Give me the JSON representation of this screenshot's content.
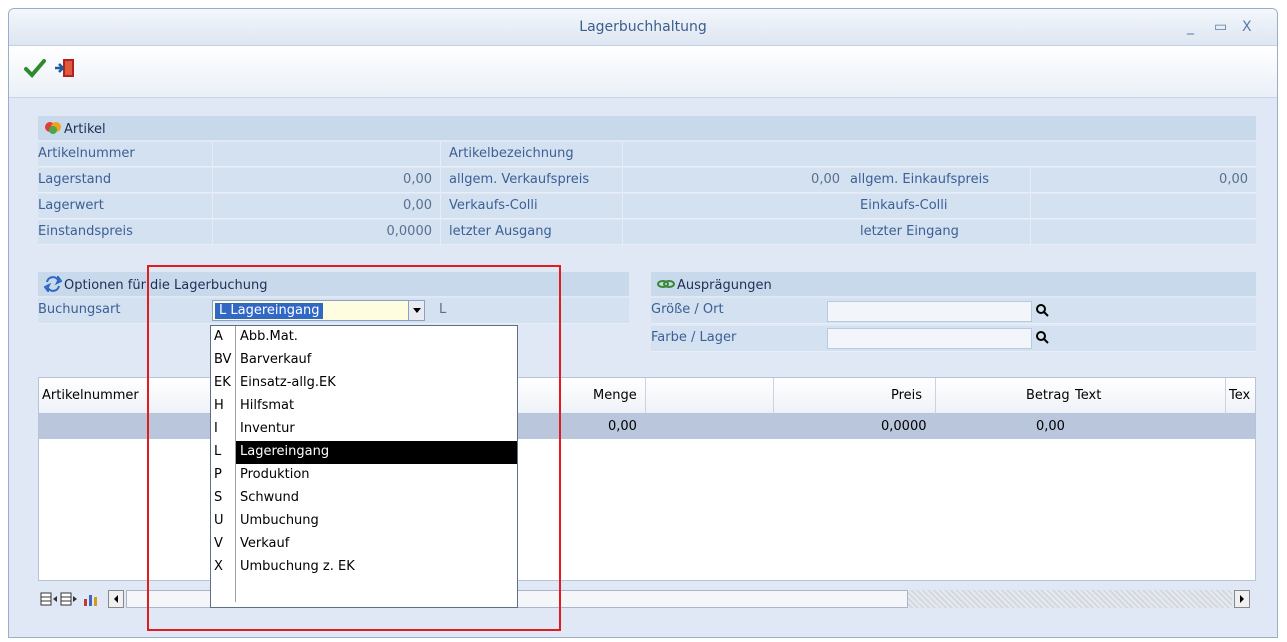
{
  "window": {
    "title": "Lagerbuchhaltung",
    "minimize": "_",
    "maximize": "▭",
    "close": "X"
  },
  "toolbar": {
    "ok_icon": "checkmark-icon",
    "exit_icon": "exit-door-icon"
  },
  "artikel": {
    "header": "Artikel",
    "fields": {
      "artikelnummer_label": "Artikelnummer",
      "artikelbezeichnung_label": "Artikelbezeichnung",
      "lagerstand_label": "Lagerstand",
      "lagerstand_value": "0,00",
      "verkaufspreis_label": "allgem. Verkaufspreis",
      "verkaufspreis_value": "0,00",
      "einkaufspreis_label": "allgem. Einkaufspreis",
      "einkaufspreis_value": "0,00",
      "lagerwert_label": "Lagerwert",
      "lagerwert_value": "0,00",
      "verkaufs_colli_label": "Verkaufs-Colli",
      "einkaufs_colli_label": "Einkaufs-Colli",
      "einstandspreis_label": "Einstandspreis",
      "einstandspreis_value": "0,0000",
      "letzter_ausgang_label": "letzter Ausgang",
      "letzter_eingang_label": "letzter Eingang"
    }
  },
  "optionen": {
    "header": "Optionen für die Lagerbuchung",
    "buchungsart_label": "Buchungsart",
    "buchungsart_value": "L  Lagereingang",
    "buchungsart_code": "L"
  },
  "auspraegungen": {
    "header": "Ausprägungen",
    "groesse_label": "Größe / Ort",
    "farbe_label": "Farbe / Lager"
  },
  "dropdown": {
    "items": [
      {
        "code": "A",
        "label": "Abb.Mat."
      },
      {
        "code": "BV",
        "label": "Barverkauf"
      },
      {
        "code": "EK",
        "label": "Einsatz-allg.EK"
      },
      {
        "code": "H",
        "label": "Hilfsmat"
      },
      {
        "code": "I",
        "label": "Inventur"
      },
      {
        "code": "L",
        "label": "Lagereingang"
      },
      {
        "code": "P",
        "label": "Produktion"
      },
      {
        "code": "S",
        "label": "Schwund"
      },
      {
        "code": "U",
        "label": "Umbuchung"
      },
      {
        "code": "V",
        "label": "Verkauf"
      },
      {
        "code": "X",
        "label": "Umbuchung z. EK"
      },
      {
        "code": "",
        "label": ""
      }
    ],
    "selected_index": 5
  },
  "grid": {
    "columns": [
      "Artikelnummer",
      "Menge",
      "Preis",
      "Betrag",
      "Text",
      "Tex"
    ],
    "row": {
      "menge": "0,00",
      "preis": "0,0000",
      "betrag": "0,00"
    }
  },
  "colors": {
    "accent": "#3168c6",
    "highlight_box": "#e21c1c"
  }
}
